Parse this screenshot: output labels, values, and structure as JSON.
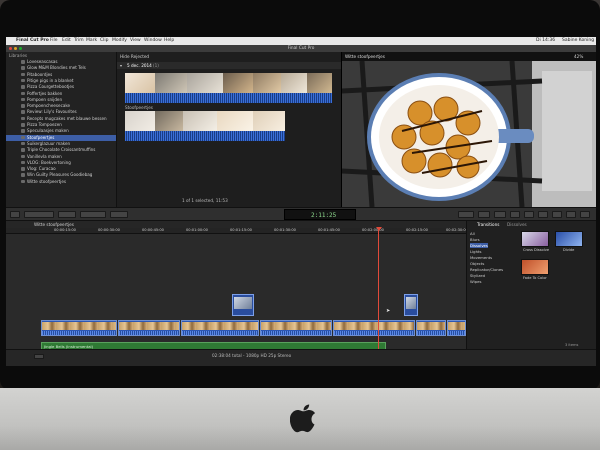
{
  "menubar": {
    "app_name": "Final Cut Pro",
    "items": [
      "File",
      "Edit",
      "Trim",
      "Mark",
      "Clip",
      "Modify",
      "View",
      "Window",
      "Help"
    ],
    "right_text": "Di 14:36",
    "user": "Sabine Koning"
  },
  "window": {
    "title": "Final Cut Pro"
  },
  "libraries": {
    "header": "Libraries",
    "items": [
      {
        "label": "Loveseascasas"
      },
      {
        "label": "Glow M&M Blondies met Tels"
      },
      {
        "label": "Pitaboordjes"
      },
      {
        "label": "Pitige pigs in a blanket"
      },
      {
        "label": "Pizza Courgettebootjes"
      },
      {
        "label": "Poffertjes bakken"
      },
      {
        "label": "Pompoen snijden"
      },
      {
        "label": "Pompoencheesecake"
      },
      {
        "label": "Review: Lily's Favourites"
      },
      {
        "label": "Recepts mugcakes met blauwe bessen"
      },
      {
        "label": "Pizza Tompoezen"
      },
      {
        "label": "Speculaasjes maken"
      },
      {
        "label": "Stoofpeertjes"
      },
      {
        "label": "Suikerglazuur maken"
      },
      {
        "label": "Triple Chocolate Croissantmuffins"
      },
      {
        "label": "Vanillevla maken"
      },
      {
        "label": "VLOG: Boekvertoning"
      },
      {
        "label": "Vlog: Curacao"
      },
      {
        "label": "Win Guilty Pleasures Goodiebag"
      },
      {
        "label": "Witte stoofpeertjes"
      }
    ]
  },
  "browser": {
    "filter": "Hide Rejected",
    "date_header": "5 dec. 2014",
    "count": "(1)",
    "clip_name": "Stoofpeertjes",
    "footer": "1 of 1 selected, 11:53"
  },
  "viewer": {
    "title": "Witte stoofpeertjes",
    "zoom": "42%"
  },
  "timecode": "2:11:25",
  "timeline": {
    "tab": "Witte stoofpeertjes",
    "ruler_marks": [
      "00:00:15:00",
      "00:00:30:00",
      "00:00:45:00",
      "00:01:00:00",
      "00:01:15:00",
      "00:01:30:00",
      "00:01:45:00",
      "00:02:00:00",
      "00:02:15:00",
      "00:02:30:00"
    ],
    "music_clip_1": "Jingle Bells (Instrumental)",
    "music_clip_2": "Jingle Bells (Instrumental)",
    "status": "02:38:04 total - 1080p HD 25p Stereo"
  },
  "transitions": {
    "title": "Transitions",
    "subtitle": "Dissolves",
    "categories": [
      "All",
      "Blurs",
      "Dissolves",
      "Lights",
      "Movements",
      "Objects",
      "Replicator/Clones",
      "Stylized",
      "Wipes"
    ],
    "items": [
      {
        "label": "Cross Dissolve"
      },
      {
        "label": "Divide"
      },
      {
        "label": "Fade To Color"
      }
    ],
    "count": "3 items"
  }
}
